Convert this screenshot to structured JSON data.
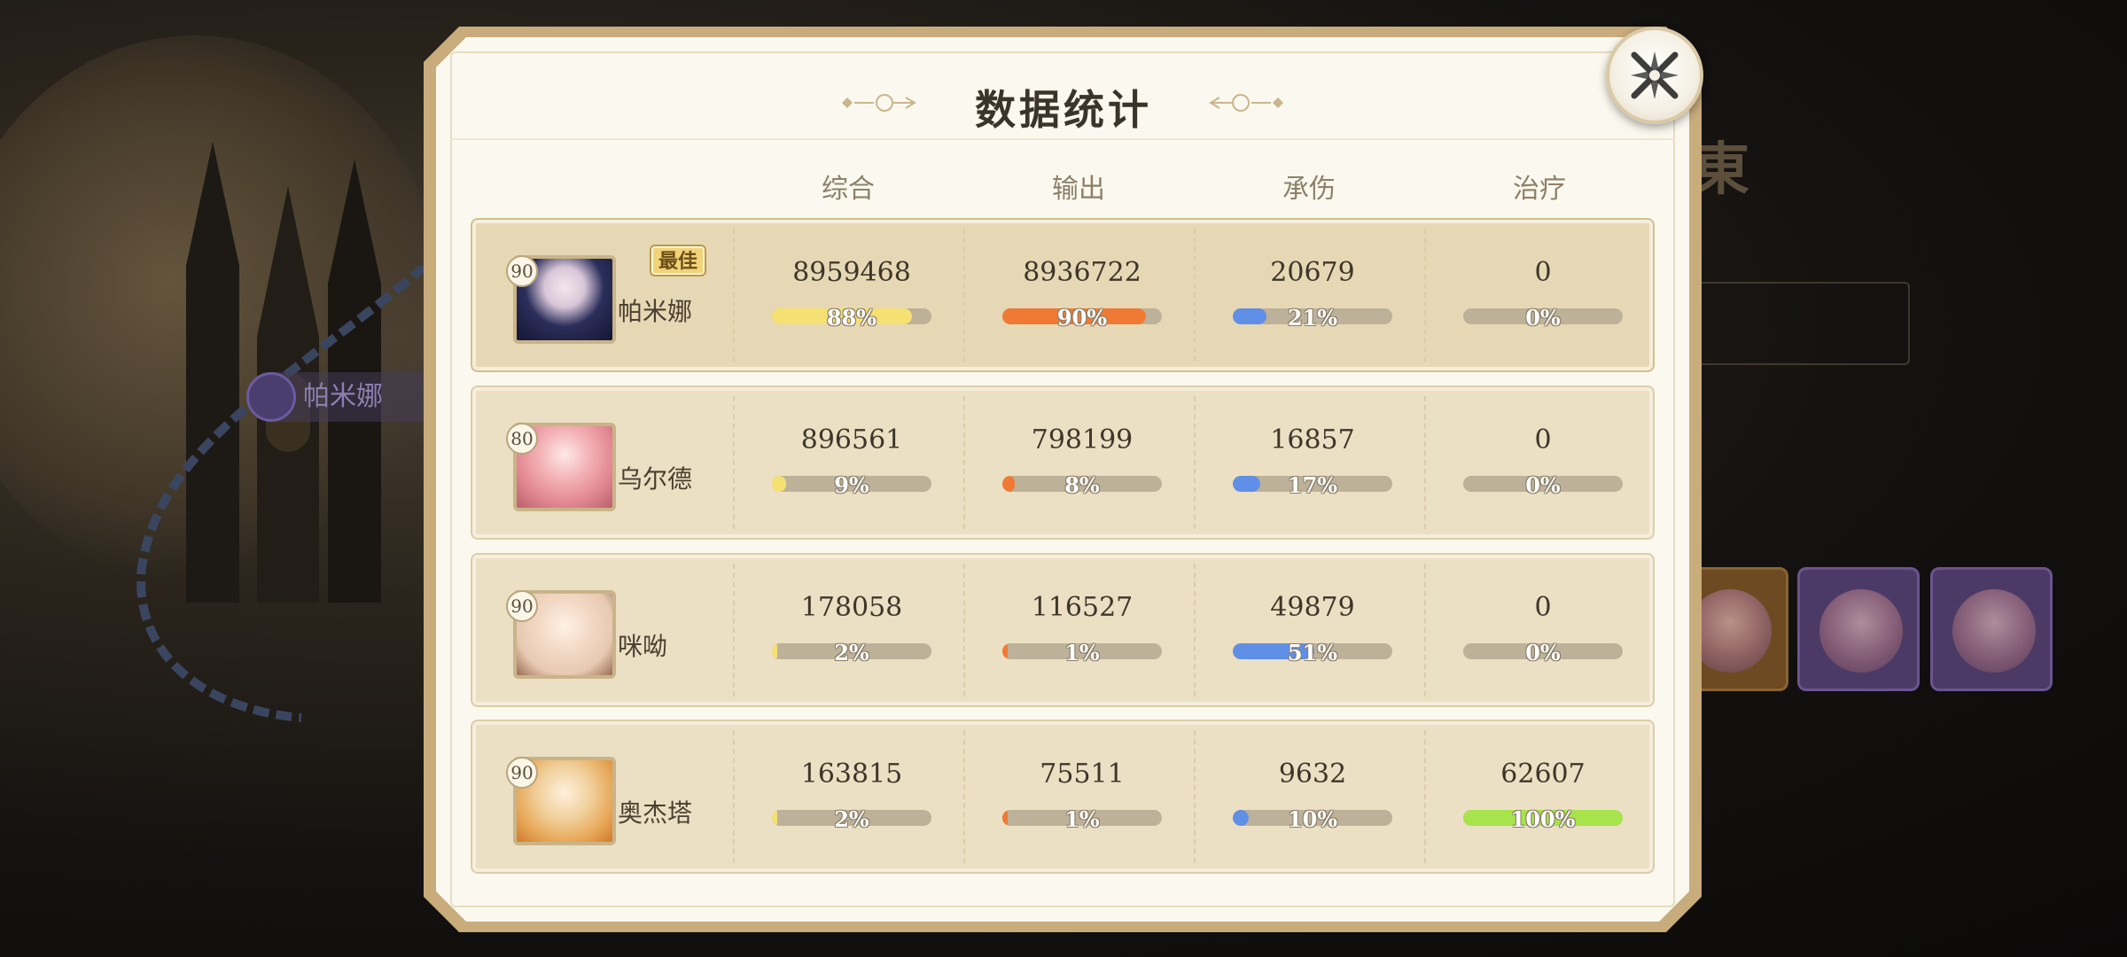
{
  "dialog": {
    "title": "数据统计",
    "close_icon": "close-x-icon"
  },
  "columns": [
    "综合",
    "输出",
    "承伤",
    "治疗"
  ],
  "best_label": "最佳",
  "colors": {
    "overall": "#f5e072",
    "damage": "#f07a34",
    "tank": "#5f8fe6",
    "heal": "#a7e34a"
  },
  "rows": [
    {
      "level": "90",
      "name": "帕米娜",
      "best": true,
      "stats": [
        {
          "value": "8959468",
          "pct": "88%",
          "fraction": 0.88
        },
        {
          "value": "8936722",
          "pct": "90%",
          "fraction": 0.9
        },
        {
          "value": "20679",
          "pct": "21%",
          "fraction": 0.21
        },
        {
          "value": "0",
          "pct": "0%",
          "fraction": 0.0
        }
      ]
    },
    {
      "level": "80",
      "name": "乌尔德",
      "best": false,
      "stats": [
        {
          "value": "896561",
          "pct": "9%",
          "fraction": 0.09
        },
        {
          "value": "798199",
          "pct": "8%",
          "fraction": 0.08
        },
        {
          "value": "16857",
          "pct": "17%",
          "fraction": 0.17
        },
        {
          "value": "0",
          "pct": "0%",
          "fraction": 0.0
        }
      ]
    },
    {
      "level": "90",
      "name": "咪呦",
      "best": false,
      "stats": [
        {
          "value": "178058",
          "pct": "2%",
          "fraction": 0.02
        },
        {
          "value": "116527",
          "pct": "1%",
          "fraction": 0.01
        },
        {
          "value": "49879",
          "pct": "51%",
          "fraction": 0.51
        },
        {
          "value": "0",
          "pct": "0%",
          "fraction": 0.0
        }
      ]
    },
    {
      "level": "90",
      "name": "奥杰塔",
      "best": false,
      "stats": [
        {
          "value": "163815",
          "pct": "2%",
          "fraction": 0.02
        },
        {
          "value": "75511",
          "pct": "1%",
          "fraction": 0.01
        },
        {
          "value": "9632",
          "pct": "10%",
          "fraction": 0.1
        },
        {
          "value": "62607",
          "pct": "100%",
          "fraction": 1.0
        }
      ]
    }
  ],
  "background": {
    "left_character": "帕米娜"
  }
}
